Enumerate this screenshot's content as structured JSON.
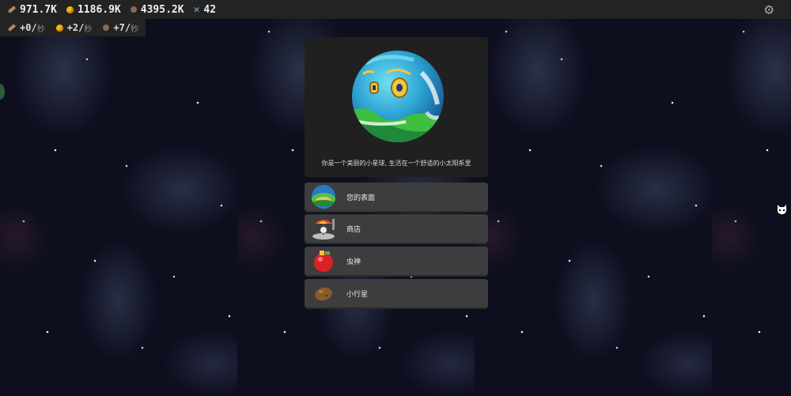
{
  "resources": {
    "wood": "971.7K",
    "coins": "1186.9K",
    "ore": "4395.2K",
    "gems": "42"
  },
  "rates": {
    "wood": "+0/",
    "coins": "+2/",
    "ore": "+7/",
    "unit": "秒"
  },
  "planet": {
    "description": "你是一个美丽的小星球, 生活在一个舒适的小太阳系里"
  },
  "menu": [
    {
      "label": "您的表面",
      "icon": "surface-icon"
    },
    {
      "label": "商店",
      "icon": "shop-icon"
    },
    {
      "label": "虫神",
      "icon": "bug-god-icon"
    },
    {
      "label": "小行星",
      "icon": "asteroid-icon"
    }
  ],
  "colors": {
    "topbar": "#232323",
    "panel": "#202020",
    "button": "#3d3d3d",
    "coin": "#f2b818",
    "gem": "#5fb8ff"
  }
}
